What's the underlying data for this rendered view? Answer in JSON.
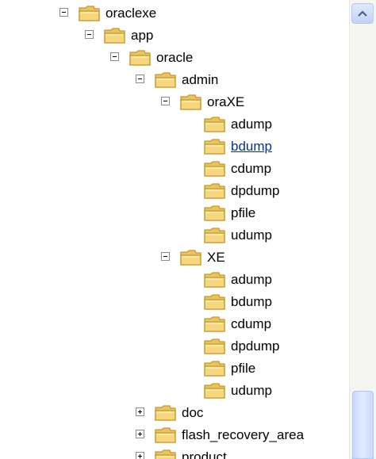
{
  "tree": {
    "nodes": [
      {
        "label": "oraclexe",
        "toggle": "minus"
      },
      {
        "label": "app",
        "toggle": "minus"
      },
      {
        "label": "oracle",
        "toggle": "minus"
      },
      {
        "label": "admin",
        "toggle": "minus"
      },
      {
        "label": "oraXE",
        "toggle": "minus"
      },
      {
        "label": "adump",
        "toggle": ""
      },
      {
        "label": "bdump",
        "toggle": "",
        "state": "hovered"
      },
      {
        "label": "cdump",
        "toggle": ""
      },
      {
        "label": "dpdump",
        "toggle": ""
      },
      {
        "label": "pfile",
        "toggle": ""
      },
      {
        "label": "udump",
        "toggle": ""
      },
      {
        "label": "XE",
        "toggle": "minus"
      },
      {
        "label": "adump",
        "toggle": ""
      },
      {
        "label": "bdump",
        "toggle": ""
      },
      {
        "label": "cdump",
        "toggle": ""
      },
      {
        "label": "dpdump",
        "toggle": ""
      },
      {
        "label": "pfile",
        "toggle": ""
      },
      {
        "label": "udump",
        "toggle": ""
      },
      {
        "label": "doc",
        "toggle": "plus"
      },
      {
        "label": "flash_recovery_area",
        "toggle": "plus"
      },
      {
        "label": "product",
        "toggle": "plus"
      }
    ]
  },
  "scrollbar": {
    "up_icon": "arrow-up-icon"
  },
  "colors": {
    "folder_fill": "#f6d77e",
    "folder_stroke": "#c59a2d",
    "link": "#0b2f8f"
  }
}
